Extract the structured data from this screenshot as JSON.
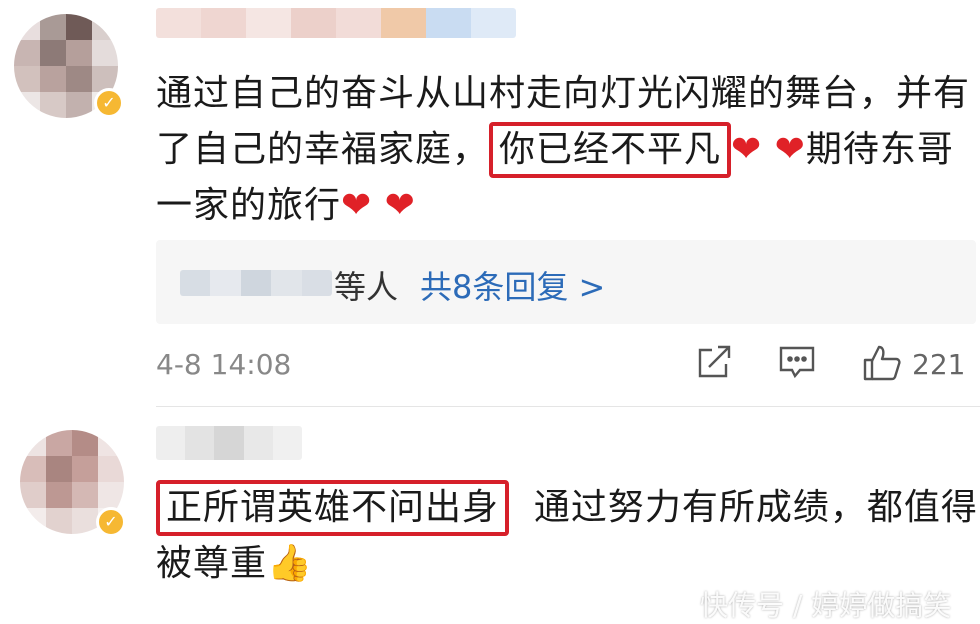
{
  "comments": [
    {
      "line1": "通过自己的奋斗从山村走向灯光闪耀的舞台，并有",
      "line2_before": "了自己的幸福家庭，",
      "line2_highlight": "你已经不平凡",
      "line2_after": "期待东哥",
      "line3": "一家的旅行",
      "heart_glyph": "❤",
      "reply_suffix": "等人",
      "reply_count": "共8条回复 >",
      "timestamp": "4-8 14:08",
      "like_count": "221"
    },
    {
      "highlight": "正所谓英雄不问出身",
      "line1_after": "通过努力有所成绩，都值得",
      "line2": "被尊重",
      "thumb_glyph": "👍"
    }
  ],
  "watermark": "快传号 / 婷婷做搞笑",
  "icons": {
    "verified": "✓",
    "share": "share-icon",
    "comment": "comment-icon",
    "like": "like-icon"
  },
  "colors": {
    "highlight_border": "#d6202a",
    "heart": "#e02127",
    "link": "#2c6bb8",
    "verified": "#f6b833"
  }
}
